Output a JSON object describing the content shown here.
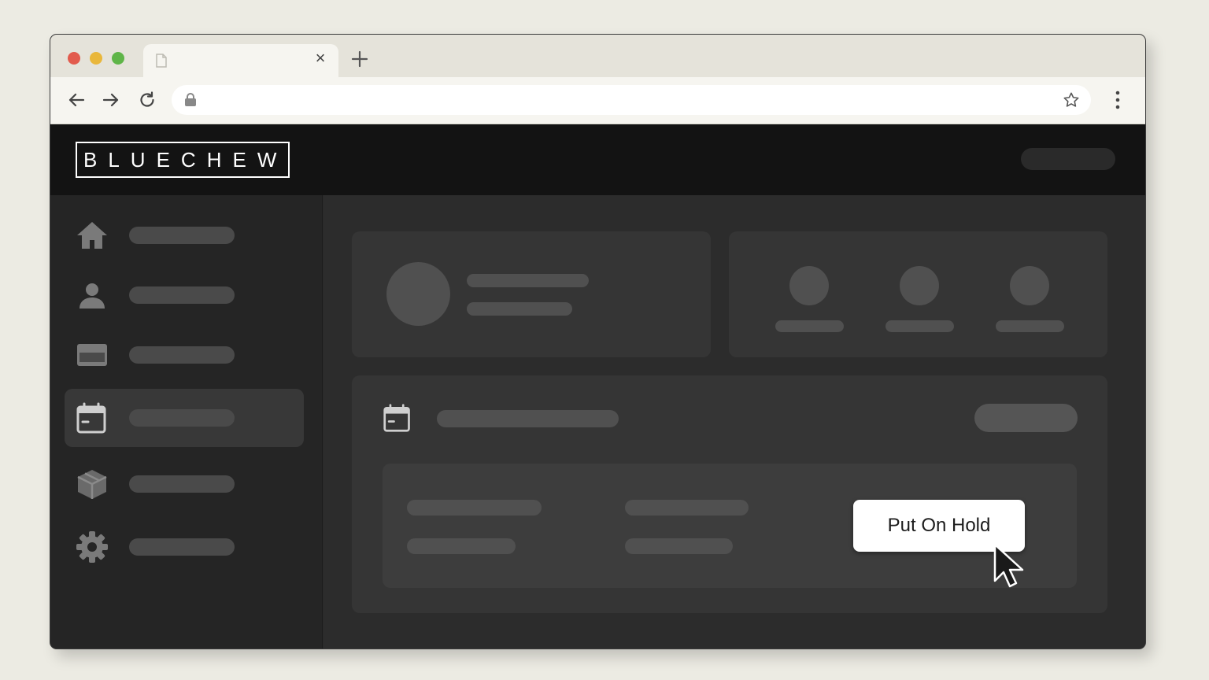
{
  "browser": {
    "tab_close_glyph": "×",
    "icons": [
      "page-icon",
      "close-icon",
      "plus-icon",
      "back-arrow-icon",
      "forward-arrow-icon",
      "reload-icon",
      "lock-icon",
      "star-icon",
      "kebab-menu-icon"
    ]
  },
  "app": {
    "logo": "BLUECHEW"
  },
  "sidebar": {
    "items": [
      {
        "icon": "home-icon",
        "active": false
      },
      {
        "icon": "user-icon",
        "active": false
      },
      {
        "icon": "card-icon",
        "active": false
      },
      {
        "icon": "calendar-icon",
        "active": true
      },
      {
        "icon": "box-icon",
        "active": false
      },
      {
        "icon": "gear-icon",
        "active": false
      }
    ]
  },
  "main": {
    "orders": {
      "icon": "calendar-icon",
      "hold_button_label": "Put On Hold"
    }
  },
  "colors": {
    "header": "#131313",
    "sidebar": "#252525",
    "active_item": "#383838",
    "button": "#ffffff"
  }
}
